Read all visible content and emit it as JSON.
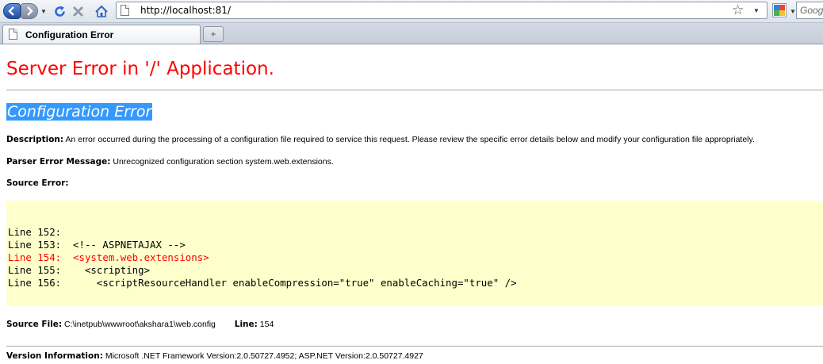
{
  "browser": {
    "url": "http://localhost:81/",
    "search_placeholder": "Google",
    "tab_title": "Configuration Error",
    "new_tab_glyph": "+",
    "icons": [
      "back-icon",
      "forward-icon",
      "reload-icon",
      "stop-icon",
      "home-icon",
      "page-icon",
      "bookmark-star-icon",
      "google-icon"
    ]
  },
  "page": {
    "title": "Server Error in '/' Application.",
    "subtitle": "Configuration Error",
    "description_label": "Description:",
    "description_text": "An error occurred during the processing of a configuration file required to service this request. Please review the specific error details below and modify your configuration file appropriately.",
    "parser_label": "Parser Error Message:",
    "parser_text": "Unrecognized configuration section system.web.extensions.",
    "source_error_label": "Source Error:",
    "code_lines": [
      {
        "text": "Line 152:",
        "highlight": false
      },
      {
        "text": "Line 153:  <!-- ASPNETAJAX -->",
        "highlight": false
      },
      {
        "text": "Line 154:  <system.web.extensions>",
        "highlight": true
      },
      {
        "text": "Line 155:    <scripting>",
        "highlight": false
      },
      {
        "text": "Line 156:      <scriptResourceHandler enableCompression=\"true\" enableCaching=\"true\" />",
        "highlight": false
      }
    ],
    "source_file_label": "Source File:",
    "source_file_path": "C:\\inetpub\\wwwroot\\akshara1\\web.config",
    "line_label": "Line:",
    "line_value": "154",
    "version_label": "Version Information:",
    "version_text": "Microsoft .NET Framework Version:2.0.50727.4952; ASP.NET Version:2.0.50727.4927"
  },
  "colors": {
    "error_red": "#ff0000",
    "selection_blue": "#3399ff",
    "code_bg": "#ffffcc"
  }
}
